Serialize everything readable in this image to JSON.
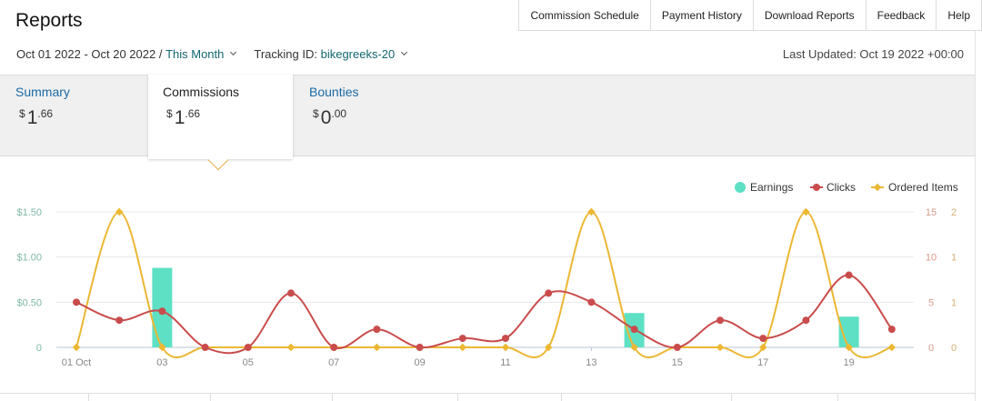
{
  "page": {
    "title": "Reports"
  },
  "topnav": [
    {
      "label": "Commission Schedule",
      "name": "commission-schedule-link"
    },
    {
      "label": "Payment History",
      "name": "payment-history-link"
    },
    {
      "label": "Download Reports",
      "name": "download-reports-link"
    },
    {
      "label": "Feedback",
      "name": "feedback-link"
    },
    {
      "label": "Help",
      "name": "help-link"
    }
  ],
  "filters": {
    "date_range": "Oct 01 2022 - Oct 20 2022 /",
    "period": "This Month",
    "tracking_label": "Tracking ID:",
    "tracking_id": "bikegreeks-20"
  },
  "last_updated": "Last Updated: Oct 19 2022 +00:00",
  "summary_tabs": [
    {
      "label": "Summary",
      "currency": "$",
      "whole": "1",
      "decimal": ".66",
      "active": false
    },
    {
      "label": "Commissions",
      "currency": "$",
      "whole": "1",
      "decimal": ".66",
      "active": true
    },
    {
      "label": "Bounties",
      "currency": "$",
      "whole": "0",
      "decimal": ".00",
      "active": false
    }
  ],
  "colors": {
    "earnings": "#5ee0c5",
    "clicks": "#c94c4c",
    "ordered": "#ecb733",
    "link": "#1a6aa6"
  },
  "chart_data": {
    "type": "bar+line",
    "legend": [
      "Earnings",
      "Clicks",
      "Ordered Items"
    ],
    "legend_position": "top-right",
    "x": [
      "01 Oct",
      "02",
      "03",
      "04",
      "05",
      "06",
      "07",
      "08",
      "09",
      "10",
      "11",
      "12",
      "13",
      "14",
      "15",
      "16",
      "17",
      "18",
      "19",
      "20"
    ],
    "x_tick_labels": [
      "01 Oct",
      "03",
      "05",
      "07",
      "09",
      "11",
      "13",
      "15",
      "17",
      "19"
    ],
    "y_left_ticks": [
      "0",
      "$0.50",
      "$1.00",
      "$1.50"
    ],
    "y_right_clicks_ticks": [
      "0",
      "5",
      "10",
      "15"
    ],
    "y_right_items_ticks": [
      "0",
      "1",
      "1",
      "2"
    ],
    "ylim_earnings": [
      0,
      1.5
    ],
    "ylim_clicks": [
      0,
      15
    ],
    "ylim_ordered": [
      0,
      2
    ],
    "series": [
      {
        "name": "Earnings",
        "type": "bar",
        "values": [
          0,
          0,
          0.88,
          0,
          0,
          0,
          0,
          0,
          0,
          0,
          0,
          0,
          0,
          0.38,
          0,
          0,
          0,
          0,
          0.34,
          0
        ]
      },
      {
        "name": "Clicks",
        "type": "line",
        "values": [
          5,
          3,
          4,
          0,
          0,
          6,
          0,
          2,
          0,
          1,
          1,
          6,
          5,
          2,
          0,
          3,
          1,
          3,
          8,
          2
        ]
      },
      {
        "name": "Ordered Items",
        "type": "line",
        "values": [
          0,
          2,
          0,
          0,
          0,
          0,
          0,
          0,
          0,
          0,
          0,
          0,
          2,
          0,
          0,
          0,
          0,
          2,
          0,
          0
        ]
      }
    ]
  }
}
